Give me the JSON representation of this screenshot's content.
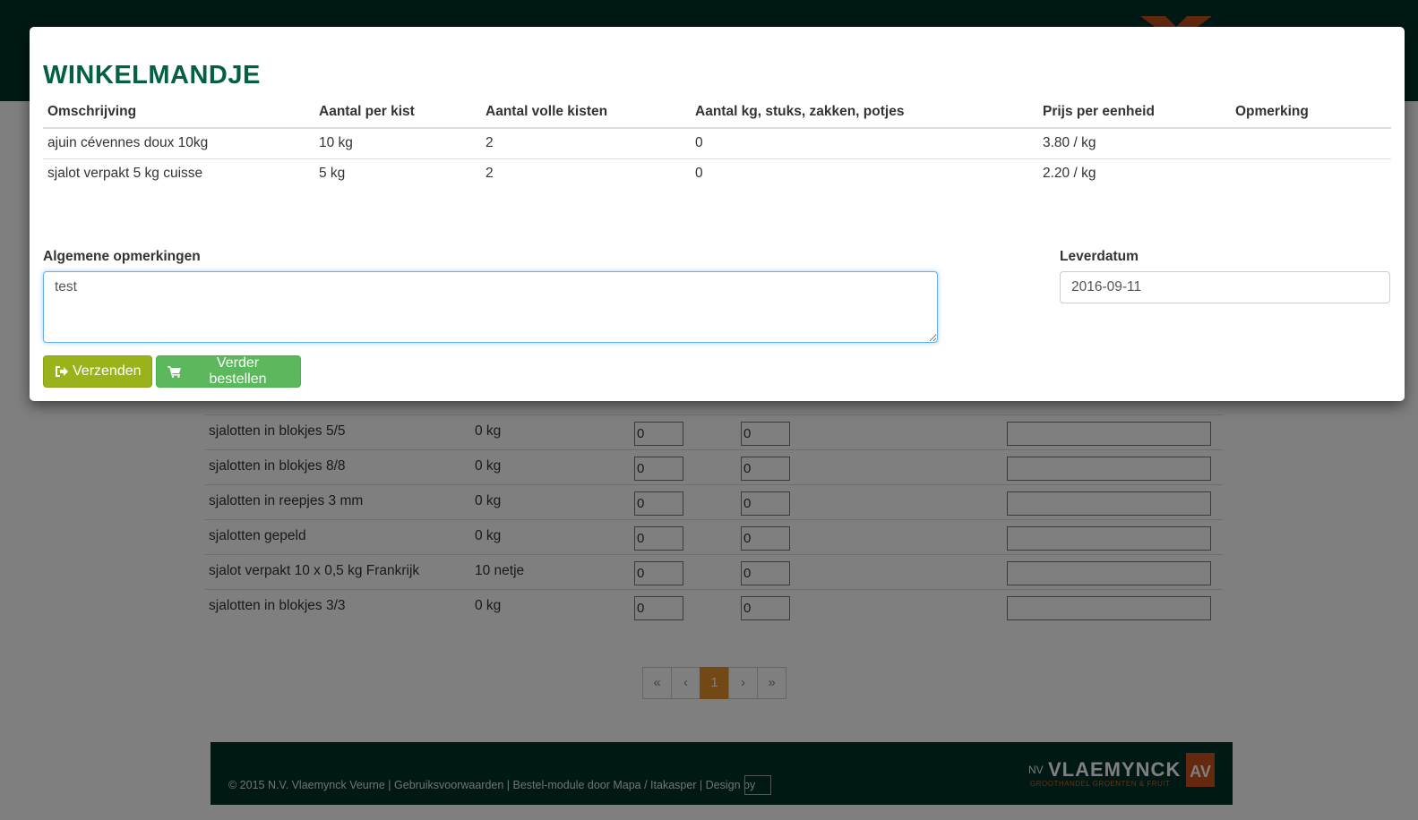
{
  "modal": {
    "title": "WINKELMANDJE",
    "columns": [
      "Omschrijving",
      "Aantal per kist",
      "Aantal volle kisten",
      "Aantal kg, stuks, zakken, potjes",
      "Prijs per eenheid",
      "Opmerking"
    ],
    "rows": [
      {
        "omschrijving": "ajuin cévennes doux 10kg",
        "per_kist": "10 kg",
        "volle_kisten": "2",
        "aantal": "0",
        "prijs": "3.80 / kg",
        "opmerking": ""
      },
      {
        "omschrijving": "sjalot verpakt 5 kg cuisse",
        "per_kist": "5 kg",
        "volle_kisten": "2",
        "aantal": "0",
        "prijs": "2.20 / kg",
        "opmerking": ""
      }
    ],
    "remarks_label": "Algemene opmerkingen",
    "remarks_value": "test",
    "date_label": "Leverdatum",
    "date_value": "2016-09-11",
    "send_label": "Verzenden",
    "continue_label": "Verder bestellen"
  },
  "background": {
    "rows": [
      {
        "name": "sjalotten in blokjes 5/5",
        "qty": "0 kg",
        "a": "0",
        "b": "0"
      },
      {
        "name": "sjalotten in blokjes 8/8",
        "qty": "0 kg",
        "a": "0",
        "b": "0"
      },
      {
        "name": "sjalotten in reepjes 3 mm",
        "qty": "0 kg",
        "a": "0",
        "b": "0"
      },
      {
        "name": "sjalotten gepeld",
        "qty": "0 kg",
        "a": "0",
        "b": "0"
      },
      {
        "name": "sjalot verpakt 10 x 0,5 kg Frankrijk",
        "qty": "10 netje",
        "a": "0",
        "b": "0"
      },
      {
        "name": "sjalotten in blokjes 3/3",
        "qty": "0 kg",
        "a": "0",
        "b": "0"
      }
    ],
    "pagination": {
      "first": "«",
      "prev": "‹",
      "current": "1",
      "next": "›",
      "last": "»"
    },
    "footer": {
      "text": "© 2015 N.V. Vlaemynck Veurne | Gebruiksvoorwaarden | Bestel-module door Mapa / Itakasper | Design by",
      "logo_prefix": "NV",
      "logo_name": "VLAEMYNCK",
      "logo_tagline": "GROOTHANDEL GROENTEN & FRUIT",
      "logo_badge": "AV"
    }
  },
  "colors": {
    "brand_dark": "#02332a",
    "title_green": "#03613f",
    "send_button": "#9bb31b",
    "continue_button": "#5cb85c",
    "active_page": "#e4932a"
  },
  "icons": {
    "send": "sign-out-icon",
    "continue": "shopping-cart-icon"
  }
}
